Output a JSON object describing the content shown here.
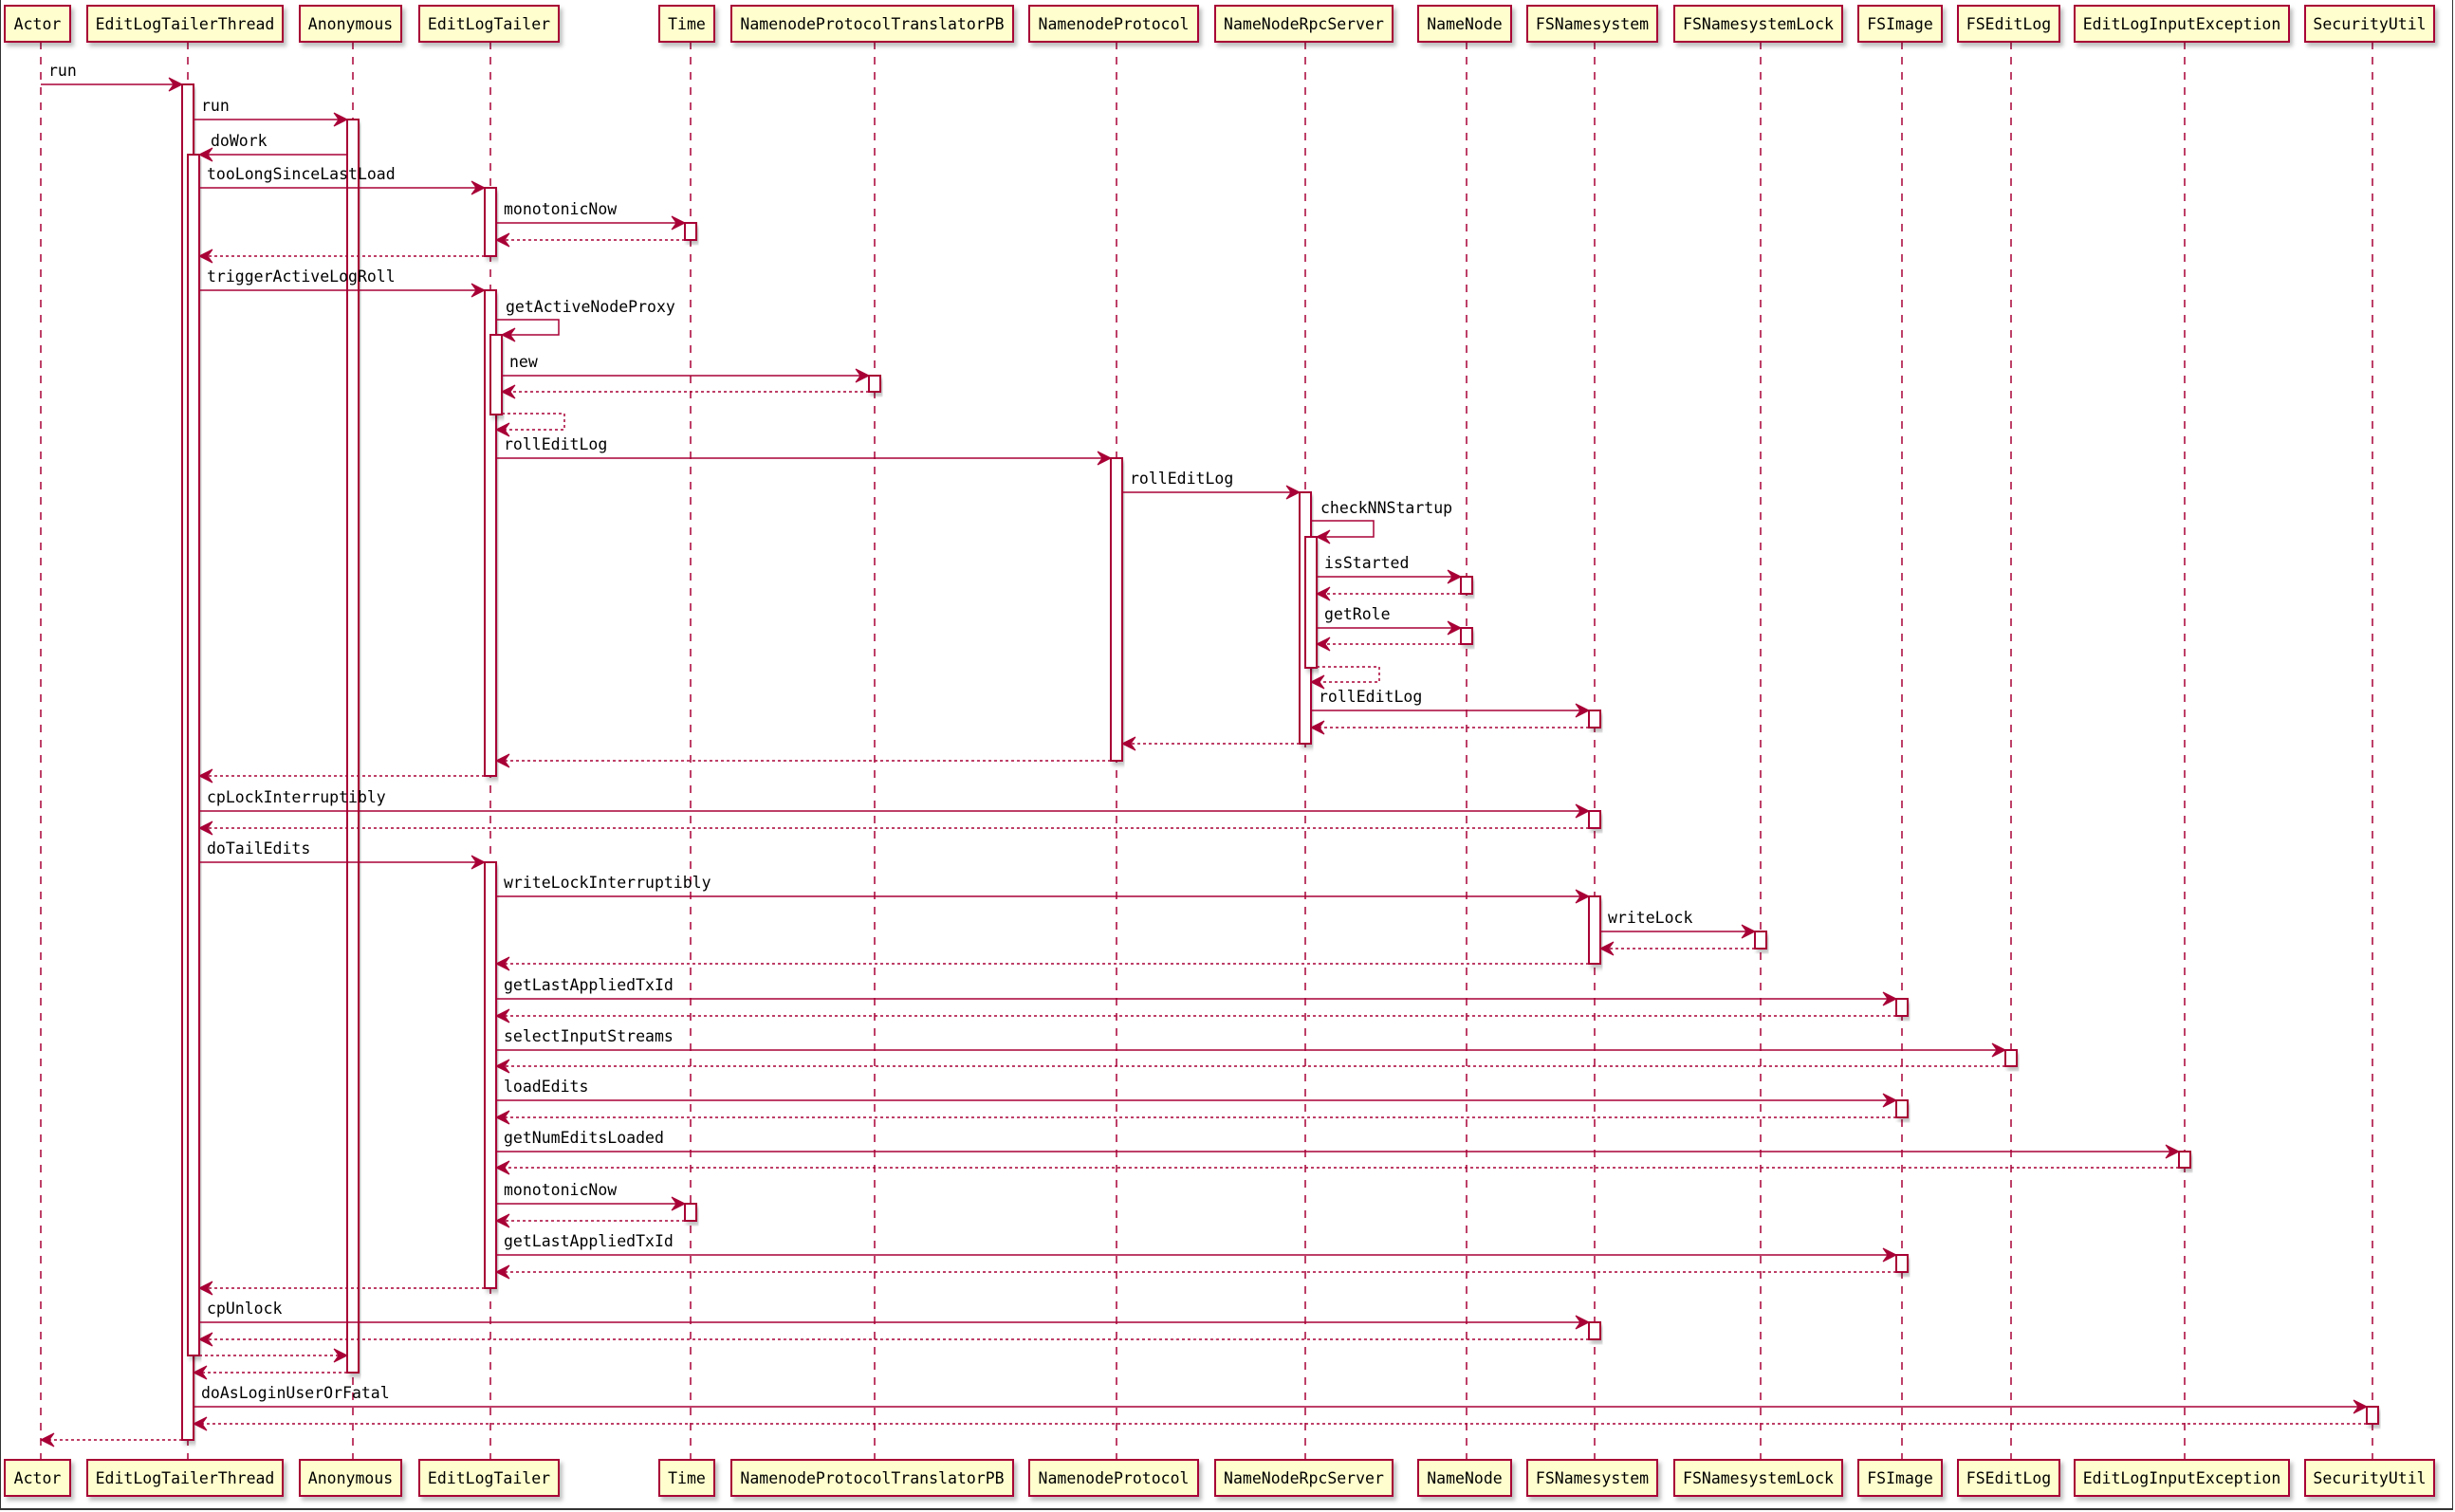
{
  "diagram": {
    "type": "sequence",
    "colors": {
      "line": "#A80036",
      "participant_fill": "#FEFECE",
      "activation_fill": "#FFFFFF",
      "text": "#000000"
    },
    "participants": [
      {
        "id": "actor",
        "name": "Actor"
      },
      {
        "id": "eltt",
        "name": "EditLogTailerThread"
      },
      {
        "id": "anon",
        "name": "Anonymous"
      },
      {
        "id": "elt",
        "name": "EditLogTailer"
      },
      {
        "id": "time",
        "name": "Time"
      },
      {
        "id": "nptpb",
        "name": "NamenodeProtocolTranslatorPB"
      },
      {
        "id": "np",
        "name": "NamenodeProtocol"
      },
      {
        "id": "nnrs",
        "name": "NameNodeRpcServer"
      },
      {
        "id": "nn",
        "name": "NameNode"
      },
      {
        "id": "fsn",
        "name": "FSNamesystem"
      },
      {
        "id": "fsnl",
        "name": "FSNamesystemLock"
      },
      {
        "id": "fsi",
        "name": "FSImage"
      },
      {
        "id": "fsel",
        "name": "FSEditLog"
      },
      {
        "id": "elie",
        "name": "EditLogInputException"
      },
      {
        "id": "su",
        "name": "SecurityUtil"
      }
    ],
    "messages": [
      {
        "from": "actor",
        "to": "eltt",
        "label": "run",
        "kind": "call"
      },
      {
        "from": "eltt",
        "to": "anon",
        "label": "run",
        "kind": "call"
      },
      {
        "from": "anon",
        "to": "eltt",
        "label": "doWork",
        "kind": "call"
      },
      {
        "from": "eltt",
        "to": "elt",
        "label": "tooLongSinceLastLoad",
        "kind": "call"
      },
      {
        "from": "elt",
        "to": "time",
        "label": "monotonicNow",
        "kind": "call"
      },
      {
        "from": "time",
        "to": "elt",
        "label": "",
        "kind": "return"
      },
      {
        "from": "elt",
        "to": "eltt",
        "label": "",
        "kind": "return"
      },
      {
        "from": "eltt",
        "to": "elt",
        "label": "triggerActiveLogRoll",
        "kind": "call"
      },
      {
        "from": "elt",
        "to": "elt",
        "label": "getActiveNodeProxy",
        "kind": "self-call"
      },
      {
        "from": "elt",
        "to": "nptpb",
        "label": "new",
        "kind": "call"
      },
      {
        "from": "nptpb",
        "to": "elt",
        "label": "",
        "kind": "return"
      },
      {
        "from": "elt",
        "to": "elt",
        "label": "",
        "kind": "self-return"
      },
      {
        "from": "elt",
        "to": "np",
        "label": "rollEditLog",
        "kind": "call"
      },
      {
        "from": "np",
        "to": "nnrs",
        "label": "rollEditLog",
        "kind": "call"
      },
      {
        "from": "nnrs",
        "to": "nnrs",
        "label": "checkNNStartup",
        "kind": "self-call"
      },
      {
        "from": "nnrs",
        "to": "nn",
        "label": "isStarted",
        "kind": "call"
      },
      {
        "from": "nn",
        "to": "nnrs",
        "label": "",
        "kind": "return"
      },
      {
        "from": "nnrs",
        "to": "nn",
        "label": "getRole",
        "kind": "call"
      },
      {
        "from": "nn",
        "to": "nnrs",
        "label": "",
        "kind": "return"
      },
      {
        "from": "nnrs",
        "to": "nnrs",
        "label": "",
        "kind": "self-return"
      },
      {
        "from": "nnrs",
        "to": "fsn",
        "label": "rollEditLog",
        "kind": "call"
      },
      {
        "from": "fsn",
        "to": "nnrs",
        "label": "",
        "kind": "return"
      },
      {
        "from": "nnrs",
        "to": "np",
        "label": "",
        "kind": "return"
      },
      {
        "from": "np",
        "to": "elt",
        "label": "",
        "kind": "return"
      },
      {
        "from": "elt",
        "to": "eltt",
        "label": "",
        "kind": "return"
      },
      {
        "from": "eltt",
        "to": "fsn",
        "label": "cpLockInterruptibly",
        "kind": "call"
      },
      {
        "from": "fsn",
        "to": "eltt",
        "label": "",
        "kind": "return"
      },
      {
        "from": "eltt",
        "to": "elt",
        "label": "doTailEdits",
        "kind": "call"
      },
      {
        "from": "elt",
        "to": "fsn",
        "label": "writeLockInterruptibly",
        "kind": "call"
      },
      {
        "from": "fsn",
        "to": "fsnl",
        "label": "writeLock",
        "kind": "call"
      },
      {
        "from": "fsnl",
        "to": "fsn",
        "label": "",
        "kind": "return"
      },
      {
        "from": "fsn",
        "to": "elt",
        "label": "",
        "kind": "return"
      },
      {
        "from": "elt",
        "to": "fsi",
        "label": "getLastAppliedTxId",
        "kind": "call"
      },
      {
        "from": "fsi",
        "to": "elt",
        "label": "",
        "kind": "return"
      },
      {
        "from": "elt",
        "to": "fsel",
        "label": "selectInputStreams",
        "kind": "call"
      },
      {
        "from": "fsel",
        "to": "elt",
        "label": "",
        "kind": "return"
      },
      {
        "from": "elt",
        "to": "fsi",
        "label": "loadEdits",
        "kind": "call"
      },
      {
        "from": "fsi",
        "to": "elt",
        "label": "",
        "kind": "return"
      },
      {
        "from": "elt",
        "to": "elie",
        "label": "getNumEditsLoaded",
        "kind": "call"
      },
      {
        "from": "elie",
        "to": "elt",
        "label": "",
        "kind": "return"
      },
      {
        "from": "elt",
        "to": "time",
        "label": "monotonicNow",
        "kind": "call"
      },
      {
        "from": "time",
        "to": "elt",
        "label": "",
        "kind": "return"
      },
      {
        "from": "elt",
        "to": "fsi",
        "label": "getLastAppliedTxId",
        "kind": "call"
      },
      {
        "from": "fsi",
        "to": "elt",
        "label": "",
        "kind": "return"
      },
      {
        "from": "elt",
        "to": "eltt",
        "label": "",
        "kind": "return"
      },
      {
        "from": "eltt",
        "to": "fsn",
        "label": "cpUnlock",
        "kind": "call"
      },
      {
        "from": "fsn",
        "to": "eltt",
        "label": "",
        "kind": "return"
      },
      {
        "from": "eltt",
        "to": "anon",
        "label": "",
        "kind": "return"
      },
      {
        "from": "anon",
        "to": "eltt",
        "label": "",
        "kind": "return"
      },
      {
        "from": "eltt",
        "to": "su",
        "label": "doAsLoginUserOrFatal",
        "kind": "call"
      },
      {
        "from": "su",
        "to": "eltt",
        "label": "",
        "kind": "return"
      },
      {
        "from": "eltt",
        "to": "actor",
        "label": "",
        "kind": "return"
      }
    ]
  }
}
